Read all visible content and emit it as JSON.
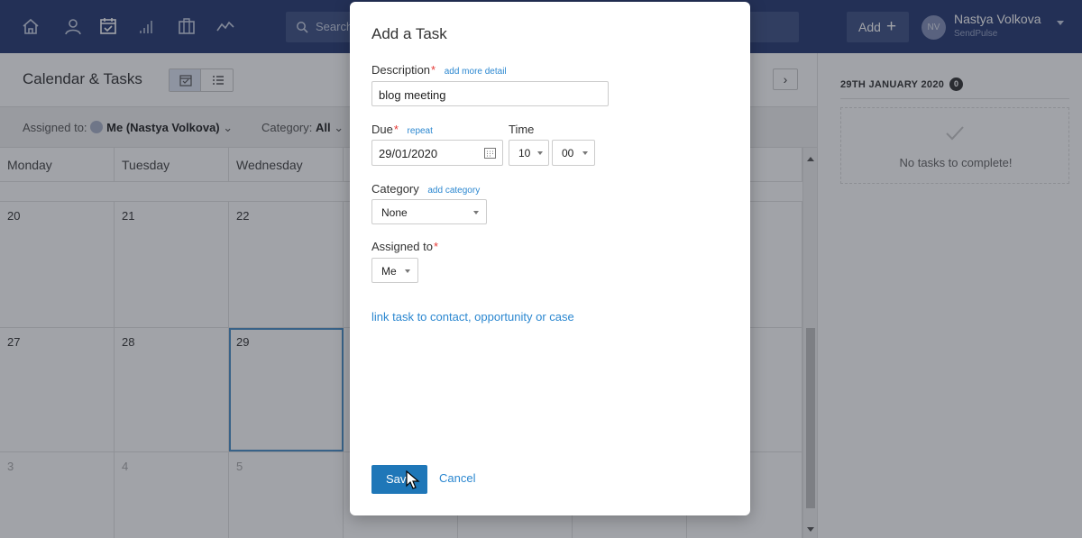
{
  "navbar": {
    "icons": [
      "home-icon",
      "contacts-icon",
      "calendar-icon",
      "reports-icon",
      "briefcase-icon",
      "activity-icon"
    ],
    "search_placeholder": "Search",
    "add_label": "Add",
    "add_plus": "+",
    "user": {
      "initials": "NV",
      "name": "Nastya Volkova",
      "company": "SendPulse"
    }
  },
  "page": {
    "title": "Calendar & Tasks",
    "next_arrow": "›"
  },
  "filters": {
    "assigned_label": "Assigned to:",
    "assigned_value": "Me (Nastya Volkova)",
    "category_label": "Category:",
    "category_value": "All",
    "chevron": "⌄"
  },
  "calendar": {
    "day_headers": [
      "Monday",
      "Tuesday",
      "Wednesday",
      "",
      "",
      "",
      ""
    ],
    "weeks": [
      {
        "days": [
          "20",
          "21",
          "22",
          "",
          "",
          "",
          ""
        ]
      },
      {
        "days": [
          "27",
          "28",
          "29",
          "",
          "",
          "",
          ""
        ]
      },
      {
        "days": [
          "3",
          "4",
          "5",
          "",
          "",
          "",
          ""
        ]
      }
    ],
    "today": "29"
  },
  "sidepanel": {
    "date_heading": "29TH JANUARY 2020",
    "count": "0",
    "empty_text": "No tasks to complete!"
  },
  "modal": {
    "title": "Add a Task",
    "description_label": "Description",
    "description_link": "add more detail",
    "description_value": "blog meeting",
    "due_label": "Due",
    "repeat_link": "repeat",
    "due_value": "29/01/2020",
    "time_label": "Time",
    "hour_value": "10",
    "minute_value": "00",
    "category_label": "Category",
    "category_link": "add category",
    "category_value": "None",
    "assigned_label": "Assigned to",
    "assigned_value": "Me",
    "required_mark": "*",
    "link_text": "link task to contact, opportunity or case",
    "save_label": "Save",
    "cancel_label": "Cancel"
  },
  "colors": {
    "navbar": "#273a72",
    "primary_button": "#1f77b8",
    "link": "#2b87d0",
    "required": "#e53935",
    "today_border": "#4a90c8"
  }
}
